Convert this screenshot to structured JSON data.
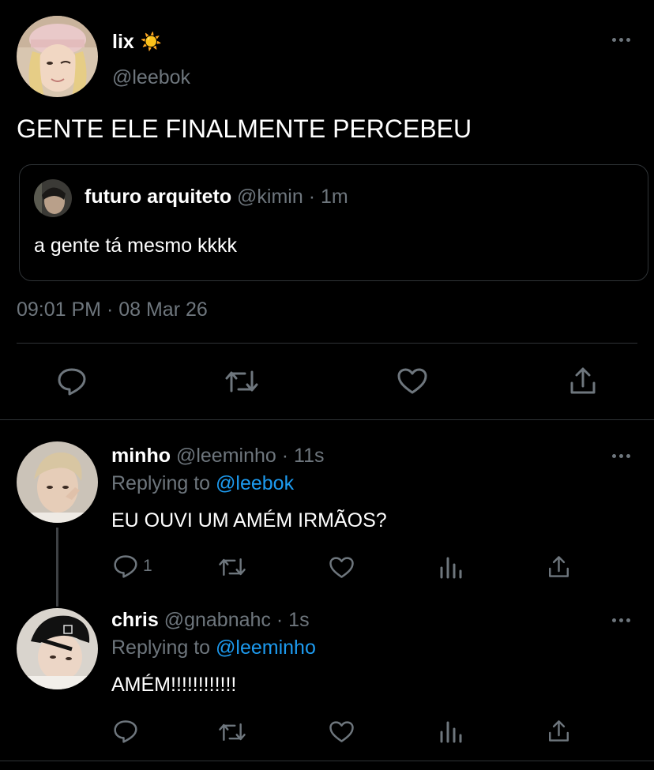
{
  "main_tweet": {
    "author_name": "lix",
    "author_emoji": "☀️",
    "handle": "@leebok",
    "text": "GENTE ELE FINALMENTE PERCEBEU",
    "quoted": {
      "author_name": "futuro arquiteto",
      "handle": "@kimin",
      "separator": "·",
      "time": "1m",
      "text": "a gente tá mesmo kkkk"
    },
    "timestamp": "09:01 PM · 08 Mar 26",
    "actions": [
      "reply-icon",
      "retweet-icon",
      "like-icon",
      "share-icon"
    ]
  },
  "replies": [
    {
      "author_name": "minho",
      "handle": "@leeminho",
      "separator": "·",
      "time": "11s",
      "replying_prefix": "Replying to",
      "replying_handle": "@leebok",
      "text": "EU OUVI UM AMÉM IRMÃOS?",
      "reply_count": "1"
    },
    {
      "author_name": "chris",
      "handle": "@gnabnahc",
      "separator": "·",
      "time": "1s",
      "replying_prefix": "Replying to",
      "replying_handle": "@leeminho",
      "text": "AMÉM!!!!!!!!!!!!",
      "reply_count": ""
    }
  ],
  "colors": {
    "background": "#000000",
    "text": "#e7e9ea",
    "muted": "#6e767d",
    "accent": "#1d9bf0",
    "divider": "#2f3336"
  }
}
